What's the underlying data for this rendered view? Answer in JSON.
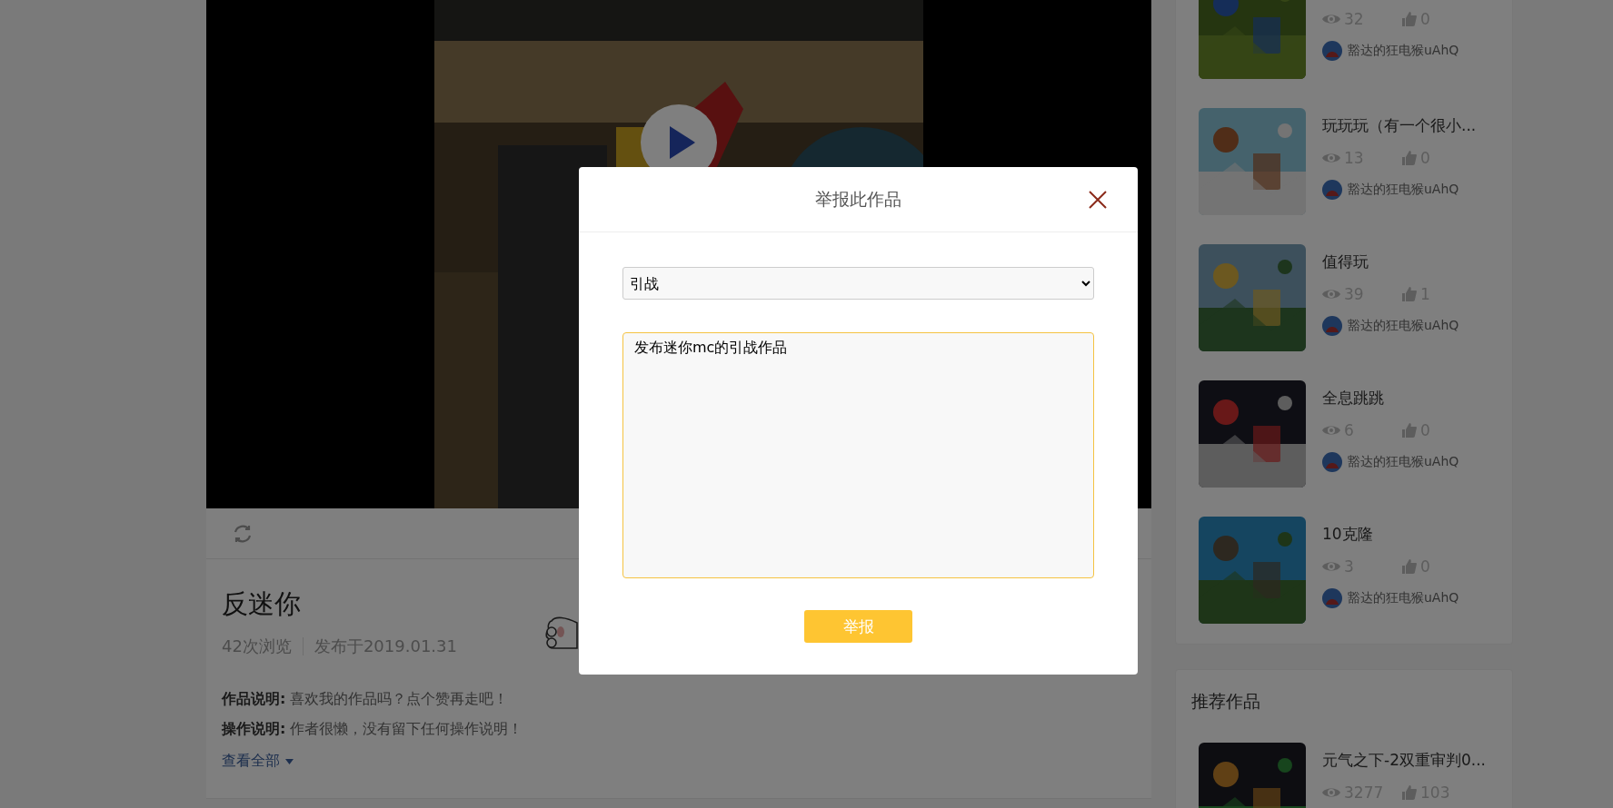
{
  "work": {
    "title": "反迷你",
    "views": "42次浏览",
    "published": "发布于2019.01.31",
    "lines": [
      "**作品说明:** 喜欢我的作品吗？点个赞再走吧！",
      "**操作说明:** 作者很懒，没有留下任何操作说明！"
    ],
    "more_link": "查看全部"
  },
  "author_works": [
    {
      "views": "32",
      "likes": "0",
      "author": "豁达的狂电猴uAhQ"
    },
    {
      "title": "玩玩玩（有一个很小...",
      "views": "13",
      "likes": "0",
      "author": "豁达的狂电猴uAhQ"
    },
    {
      "title": "值得玩",
      "views": "39",
      "likes": "1",
      "author": "豁达的狂电猴uAhQ"
    },
    {
      "title": "全息跳跳",
      "views": "6",
      "likes": "0",
      "author": "豁达的狂电猴uAhQ"
    },
    {
      "title": "10克隆",
      "views": "3",
      "likes": "0",
      "author": "豁达的狂电猴uAhQ"
    }
  ],
  "recommended": {
    "title": "推荐作品",
    "items": [
      {
        "title": "元气之下-2双重审判0...",
        "views": "3277",
        "likes": "103"
      }
    ]
  },
  "report_dialog": {
    "title": "举报此作品",
    "reason": "引战",
    "details": "发布迷你mc的引战作品",
    "submit": "举报"
  }
}
